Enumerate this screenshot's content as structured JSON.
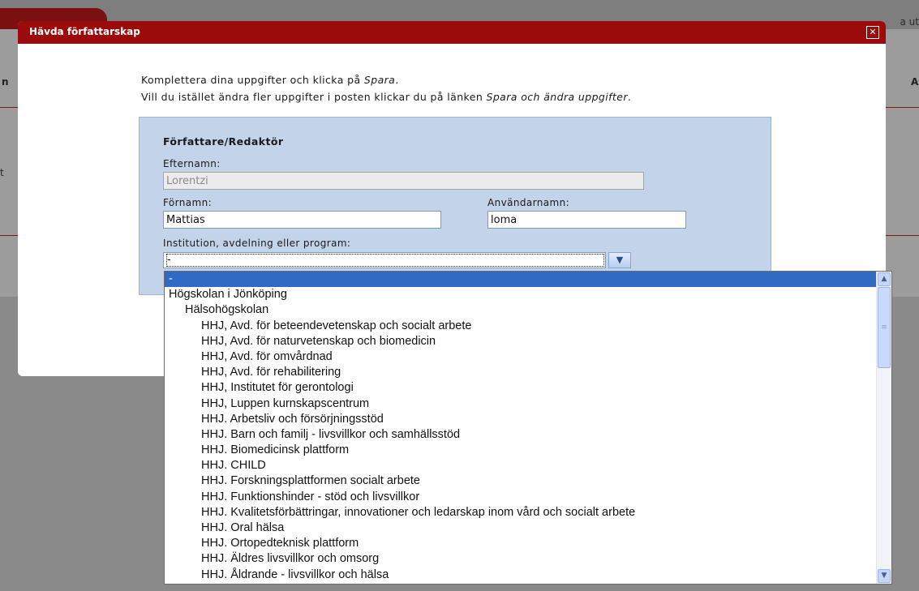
{
  "background": {
    "top_right_text": "a ut",
    "edge_letters": [
      "n",
      "A",
      "t"
    ]
  },
  "dialog": {
    "title": "Hävda författarskap",
    "close_glyph": "✕",
    "intro": {
      "line1_prefix": "Komplettera dina uppgifter och klicka på ",
      "line1_em": "Spara",
      "line1_suffix": ".",
      "line2_prefix": "Vill du istället ändra fler uppgifter i posten klickar du på länken ",
      "line2_em": "Spara och ändra uppgifter",
      "line2_suffix": "."
    },
    "panel": {
      "heading": "Författare/Redaktör",
      "lastname_label": "Efternamn:",
      "lastname_value": "Lorentzi",
      "firstname_label": "Förnamn:",
      "firstname_value": "Mattias",
      "username_label": "Användarnamn:",
      "username_value": "loma",
      "institution_label": "Institution, avdelning eller program:",
      "institution_selected": "-"
    }
  },
  "dropdown": {
    "options": [
      {
        "label": "-",
        "level": 0,
        "selected": true
      },
      {
        "label": "Högskolan i Jönköping",
        "level": 0
      },
      {
        "label": "Hälsohögskolan",
        "level": 1
      },
      {
        "label": "HHJ, Avd. för beteendevetenskap och socialt arbete",
        "level": 2
      },
      {
        "label": "HHJ, Avd. för naturvetenskap och biomedicin",
        "level": 2
      },
      {
        "label": "HHJ, Avd. för omvårdnad",
        "level": 2
      },
      {
        "label": "HHJ, Avd. för rehabilitering",
        "level": 2
      },
      {
        "label": "HHJ, Institutet för gerontologi",
        "level": 2
      },
      {
        "label": "HHJ, Luppen kurnskapscentrum",
        "level": 2
      },
      {
        "label": "HHJ. Arbetsliv och försörjningsstöd",
        "level": 2
      },
      {
        "label": "HHJ. Barn och familj - livsvillkor och samhällsstöd",
        "level": 2
      },
      {
        "label": "HHJ. Biomedicinsk plattform",
        "level": 2
      },
      {
        "label": "HHJ. CHILD",
        "level": 2
      },
      {
        "label": "HHJ. Forskningsplattformen socialt arbete",
        "level": 2
      },
      {
        "label": "HHJ. Funktionshinder - stöd och livsvillkor",
        "level": 2
      },
      {
        "label": "HHJ. Kvalitetsförbättringar, innovationer och ledarskap inom vård och socialt arbete",
        "level": 2
      },
      {
        "label": "HHJ. Oral hälsa",
        "level": 2
      },
      {
        "label": "HHJ. Ortopedteknisk plattform",
        "level": 2
      },
      {
        "label": "HHJ. Äldres livsvillkor och omsorg",
        "level": 2
      },
      {
        "label": "HHJ. Åldrande - livsvillkor och hälsa",
        "level": 2
      }
    ]
  }
}
